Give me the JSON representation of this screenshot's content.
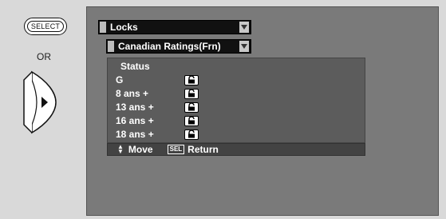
{
  "remote": {
    "select_label": "SELECT",
    "or_label": "OR"
  },
  "menu": {
    "locks_label": "Locks",
    "ratings_label": "Canadian Ratings(Frn)"
  },
  "panel": {
    "status_label": "Status",
    "ratings": [
      {
        "name": "G",
        "lock": "unlocked"
      },
      {
        "name": "8 ans +",
        "lock": "unlocked"
      },
      {
        "name": "13 ans +",
        "lock": "unlocked"
      },
      {
        "name": "16 ans +",
        "lock": "unlocked"
      },
      {
        "name": "18 ans +",
        "lock": "unlocked"
      }
    ]
  },
  "footer": {
    "move_label": "Move",
    "sel_badge": "SEL",
    "return_label": "Return"
  }
}
